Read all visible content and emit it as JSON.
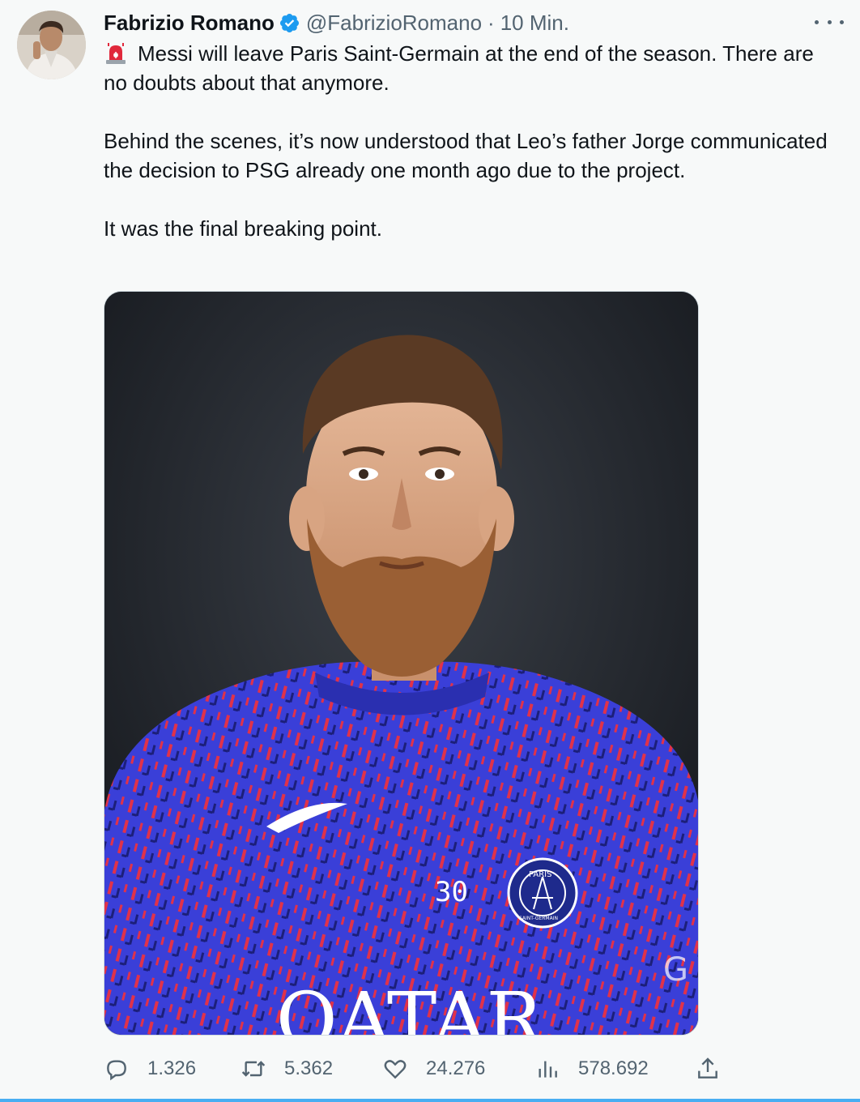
{
  "tweet": {
    "author_name": "Fabrizio Romano",
    "handle": "@FabrizioRomano",
    "separator": "·",
    "time": "10 Min.",
    "paragraphs": [
      "Messi will leave Paris Saint-Germain at the end of the season. There are no doubts about that anymore.",
      "Behind the scenes, it’s now understood that Leo’s father Jorge communicated the decision to PSG already one month ago due to the project.",
      "It was the final breaking point."
    ],
    "lead_icon": "rotating-light-siren-icon",
    "more_icon": "more-horizontal-icon"
  },
  "media": {
    "jersey_number": "30",
    "sponsor_text": "QATAR",
    "crest_text_top": "PARIS",
    "crest_text_bottom": "SAINT-GERMAIN",
    "corner_text": "G"
  },
  "actions": {
    "replies": "1.326",
    "retweets": "5.362",
    "likes": "24.276",
    "views": "578.692",
    "icons": [
      "reply-icon",
      "retweet-icon",
      "like-icon",
      "views-icon",
      "share-icon"
    ]
  },
  "colors": {
    "background": "#f7f9f9",
    "text": "#0f1419",
    "secondary": "#536471",
    "verified": "#1d9bf0",
    "jersey_blue": "#3a3fd8",
    "jersey_red": "#e0324a"
  }
}
